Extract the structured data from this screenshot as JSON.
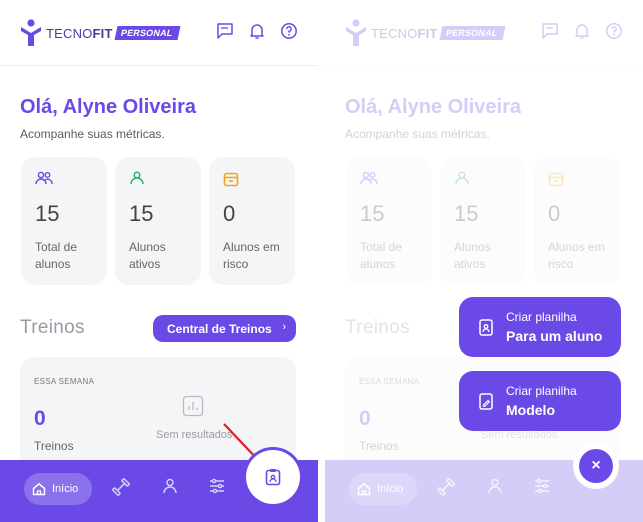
{
  "brand": {
    "name_light": "TECNO",
    "name_bold": "FIT",
    "badge": "PERSONAL",
    "color": "#6b49e6"
  },
  "header_icons": [
    "chat-icon",
    "bell-icon",
    "help-icon"
  ],
  "greeting": "Olá, Alyne Oliveira",
  "subtitle": "Acompanhe suas métricas.",
  "metrics": [
    {
      "icon": "users-icon",
      "value": "15",
      "label": "Total de alunos",
      "color": "#6b49e6"
    },
    {
      "icon": "user-icon",
      "value": "15",
      "label": "Alunos ativos",
      "color": "#2bb36b"
    },
    {
      "icon": "calendar-icon",
      "value": "0",
      "label": "Alunos em risco",
      "color": "#f2a516"
    }
  ],
  "treinos": {
    "title": "Treinos",
    "central_button": "Central de Treinos",
    "week_label": "ESSA SEMANA",
    "count": "0",
    "count_label": "Treinos",
    "empty_text": "Sem resultados"
  },
  "nav": {
    "home_label": "Início",
    "items": [
      "dumbbell-icon",
      "user-icon",
      "sliders-icon"
    ]
  },
  "fab_menu": {
    "option1": {
      "line1": "Criar planilha",
      "line2": "Para um aluno"
    },
    "option2": {
      "line1": "Criar planilha",
      "line2": "Modelo"
    },
    "close": "×"
  }
}
